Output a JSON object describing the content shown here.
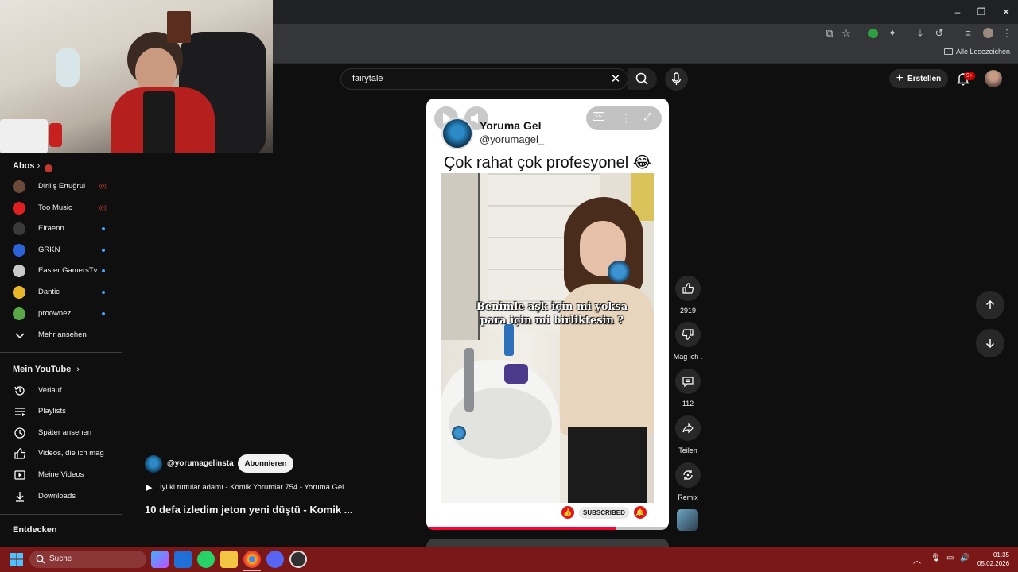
{
  "browser": {
    "bookmarks_all": "Alle Lesezeichen"
  },
  "search": {
    "query": "fairytale"
  },
  "header": {
    "create_label": "Erstellen",
    "notifications_badge": "9+"
  },
  "sidebar": {
    "subs_title": "Abos",
    "subscriptions": [
      {
        "name": "Diriliş Ertuğrul",
        "status": "live",
        "avatar_color": "#6b4a3c"
      },
      {
        "name": "Too Music",
        "status": "live",
        "avatar_color": "#e02020"
      },
      {
        "name": "Elraenn",
        "status": "new",
        "avatar_color": "#3a3a3a"
      },
      {
        "name": "GRKN",
        "status": "new",
        "avatar_color": "#2d62d8"
      },
      {
        "name": "Easter GamersTv",
        "status": "new",
        "avatar_color": "#c9c9c9"
      },
      {
        "name": "Dantic",
        "status": "new",
        "avatar_color": "#e7b629"
      },
      {
        "name": "proownez",
        "status": "new",
        "avatar_color": "#5aa845"
      }
    ],
    "more_label": "Mehr ansehen",
    "you_title": "Mein YouTube",
    "you_items": [
      {
        "label": "Verlauf",
        "icon": "history-icon"
      },
      {
        "label": "Playlists",
        "icon": "playlists-icon"
      },
      {
        "label": "Später ansehen",
        "icon": "watch-later-icon"
      },
      {
        "label": "Videos, die ich mag",
        "icon": "liked-videos-icon"
      },
      {
        "label": "Meine Videos",
        "icon": "my-videos-icon"
      },
      {
        "label": "Downloads",
        "icon": "downloads-icon"
      }
    ],
    "explore_title": "Entdecken"
  },
  "short": {
    "channel_name": "Yoruma Gel",
    "channel_handle": "@yorumagel_",
    "caption": "Çok rahat çok profesyonel 😂",
    "overlay_text": "Benimle aşk için mi yoksa para için mi birliktesin ?",
    "subscribed_label": "SUBSCRIBED",
    "progress": 0.78
  },
  "actions": {
    "likes": "2919",
    "dislike_label": "Mag ich .",
    "comments": "112",
    "share_label": "Teilen",
    "remix_label": "Remix"
  },
  "info": {
    "handle": "@yorumagelinsta",
    "subscribe_label": "Abonnieren",
    "playlist": "İyi ki tuttular adamı - Komik Yorumlar 754 - Yoruma Gel ...",
    "title": "10 defa izledim jeton yeni düştü  - Komik ..."
  },
  "taskbar": {
    "search_label": "Suche",
    "time": "01:35",
    "date": "05.02.2026"
  },
  "colors": {
    "accent": "#ff0033",
    "taskbar": "#7a1717",
    "background": "#0f0f0f"
  }
}
